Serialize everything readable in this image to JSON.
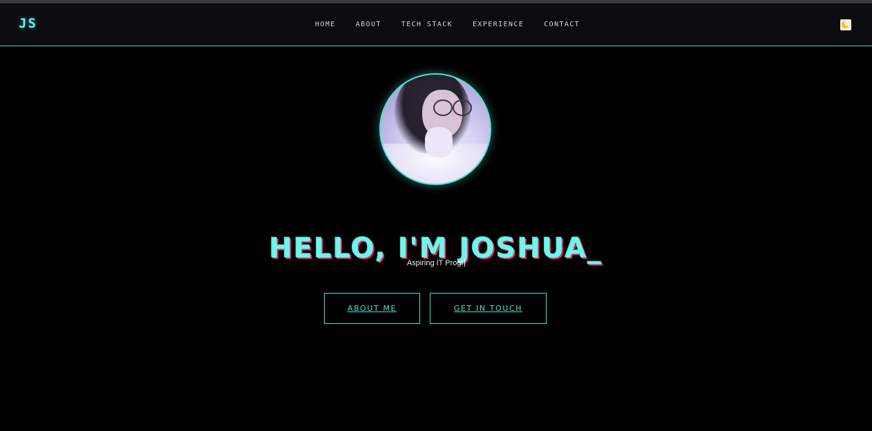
{
  "navbar": {
    "logo": "JS",
    "links": [
      "HOME",
      "ABOUT",
      "TECH STACK",
      "EXPERIENCE",
      "CONTACT"
    ],
    "theme_toggle_icon": "moon-icon"
  },
  "hero": {
    "title": "HELLO, I'M JOSHUA_",
    "subtitle": "Aspiring IT Progr",
    "buttons": {
      "about": "ABOUT ME",
      "contact": "GET IN TOUCH"
    }
  },
  "colors": {
    "accent": "#4fe3d5",
    "title_shadow": "#e0245e",
    "background": "#000000",
    "navbar": "#0b0b10"
  }
}
